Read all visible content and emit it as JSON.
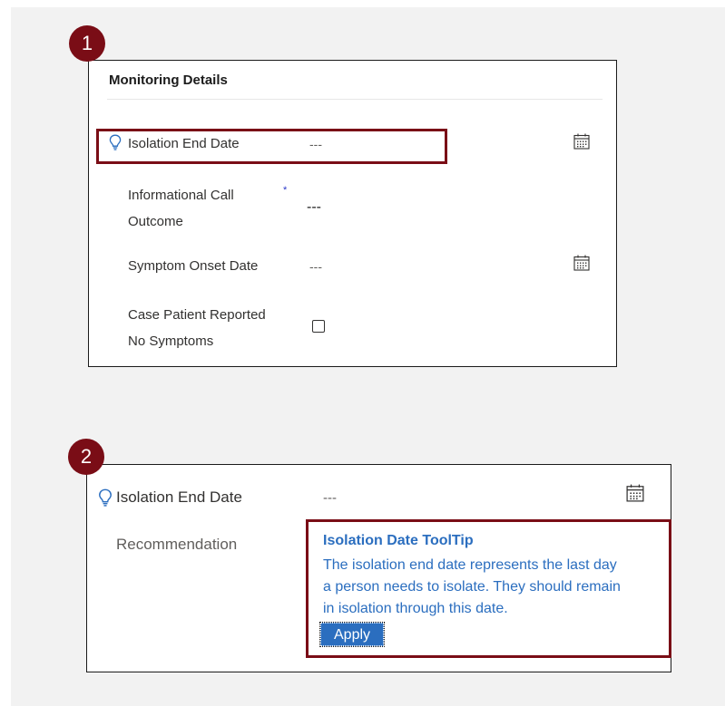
{
  "markers": {
    "one": "1",
    "two": "2"
  },
  "panel1": {
    "section_title": "Monitoring Details",
    "isolation": {
      "label": "Isolation End Date",
      "value": "---"
    },
    "call_outcome": {
      "label_line1": "Informational Call",
      "label_line2": "Outcome",
      "required_mark": "*",
      "value": "---"
    },
    "symptom_onset": {
      "label": "Symptom Onset Date",
      "value": "---"
    },
    "no_symptoms": {
      "label_line1": "Case Patient Reported",
      "label_line2": "No Symptoms",
      "checked": false
    }
  },
  "panel2": {
    "isolation": {
      "label": "Isolation End Date",
      "value": "---"
    },
    "recommendation_label": "Recommendation",
    "tooltip": {
      "title": "Isolation Date ToolTip",
      "line1": "The isolation end date represents the last day",
      "line2": "a person needs to isolate. They should remain",
      "line3": "in isolation through this date.",
      "apply_label": "Apply"
    }
  },
  "colors": {
    "accent": "#7a0d16",
    "link": "#2b6ebf",
    "required": "#2b37c8"
  },
  "icons": [
    "bulb-icon",
    "calendar-icon",
    "arrow-icon"
  ]
}
